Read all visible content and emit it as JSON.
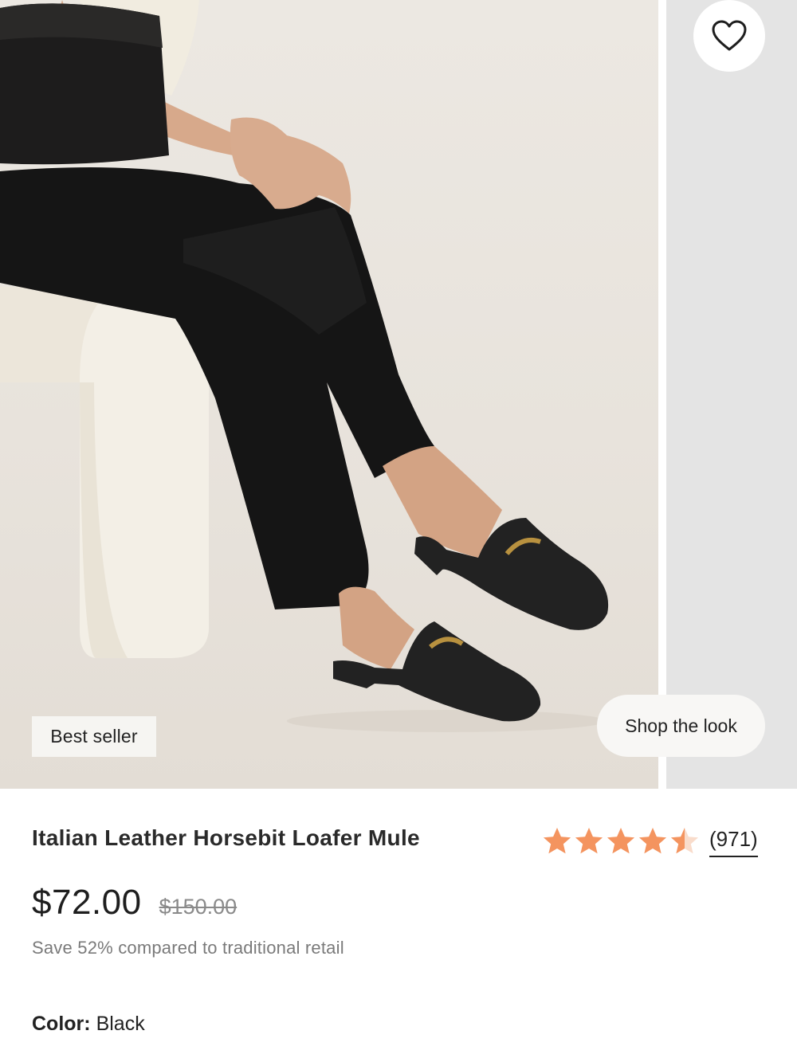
{
  "hero": {
    "badge": "Best seller",
    "shop_the_look": "Shop the look",
    "favorite_icon": "heart-icon"
  },
  "product": {
    "title": "Italian Leather Horsebit Loafer Mule",
    "rating": 4.5,
    "rating_max": 5,
    "review_count": "(971)",
    "star_color": "#f4945f",
    "price": "$72.00",
    "compare_price": "$150.00",
    "savings": "Save 52% compared to traditional retail",
    "color_label": "Color:",
    "color_value": "Black"
  }
}
